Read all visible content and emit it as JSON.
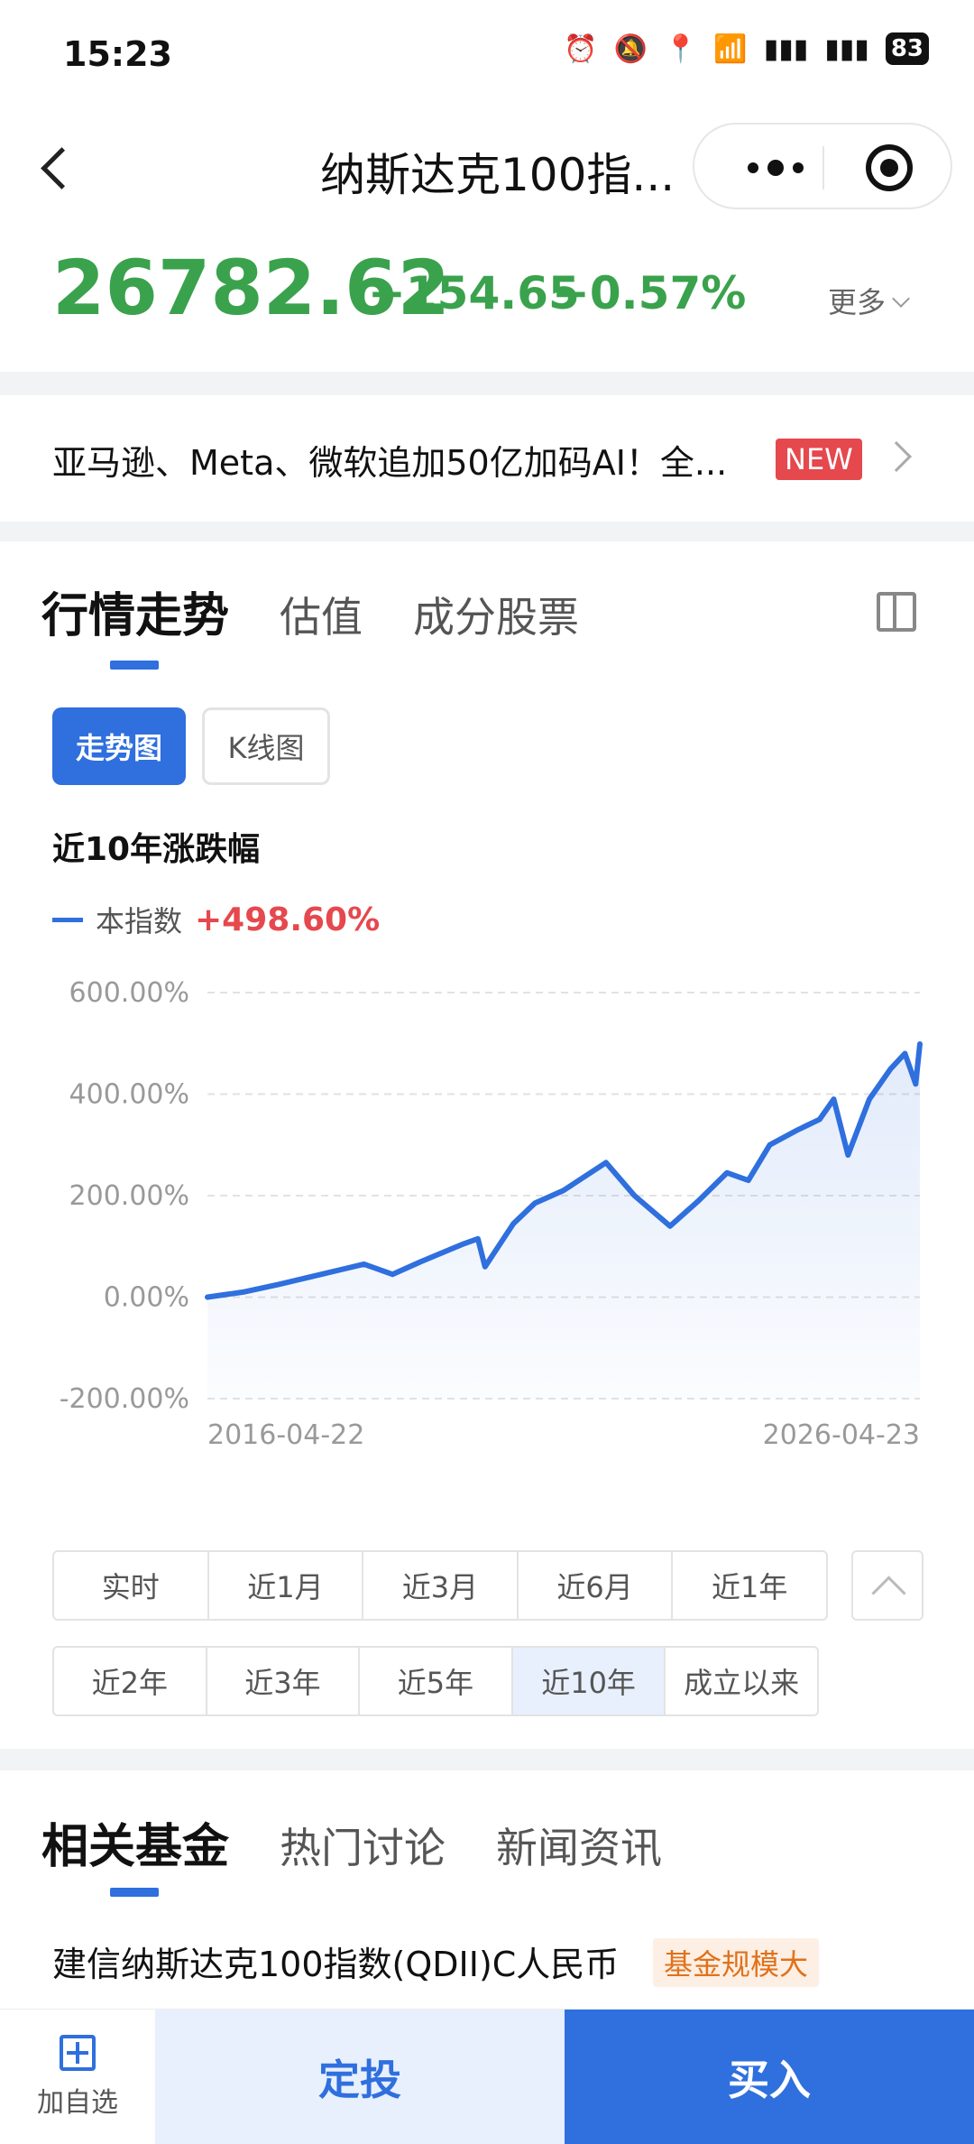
{
  "status": {
    "time": "15:23",
    "battery": "83"
  },
  "nav": {
    "title": "纳斯达克100指..."
  },
  "quote": {
    "price": "26782.62",
    "change": "−154.65",
    "change_pct": "−0.57%",
    "more": "更多"
  },
  "news": {
    "headline": "亚马逊、Meta、微软追加50亿加码AI！全...",
    "badge": "NEW"
  },
  "market_tabs": [
    "行情走势",
    "估值",
    "成分股票"
  ],
  "chart_types": {
    "trend": "走势图",
    "kline": "K线图"
  },
  "period_title": "近10年涨跌幅",
  "legend": {
    "name": "本指数",
    "value": "+498.60%"
  },
  "chart_data": {
    "type": "area",
    "ylim": [
      -200,
      600
    ],
    "y_ticks": [
      "600.00%",
      "400.00%",
      "200.00%",
      "0.00%",
      "-200.00%"
    ],
    "x_start_label": "2016-04-22",
    "x_end_label": "2026-04-23",
    "series": [
      {
        "name": "本指数",
        "color": "#2f6fde",
        "x": [
          2016.3,
          2016.8,
          2017.3,
          2017.9,
          2018.5,
          2018.9,
          2019.3,
          2019.9,
          2020.1,
          2020.2,
          2020.6,
          2020.9,
          2021.3,
          2021.9,
          2022.3,
          2022.8,
          2023.2,
          2023.6,
          2023.9,
          2024.2,
          2024.6,
          2024.9,
          2025.1,
          2025.3,
          2025.6,
          2025.9,
          2026.1,
          2026.25,
          2026.31
        ],
        "values": [
          0,
          10,
          25,
          45,
          65,
          45,
          70,
          105,
          115,
          60,
          145,
          185,
          210,
          265,
          200,
          140,
          190,
          245,
          230,
          300,
          330,
          350,
          390,
          280,
          390,
          450,
          480,
          420,
          498.6
        ]
      }
    ]
  },
  "range_row1": [
    "实时",
    "近1月",
    "近3月",
    "近6月",
    "近1年"
  ],
  "range_row2": [
    "近2年",
    "近3年",
    "近5年",
    "近10年",
    "成立以来"
  ],
  "selected_range": "近10年",
  "related_tabs": [
    "相关基金",
    "热门讨论",
    "新闻资讯"
  ],
  "fund": {
    "name": "建信纳斯达克100指数(QDII)C人民币",
    "tag": "基金规模大"
  },
  "bottom": {
    "watch": "加自选",
    "sip": "定投",
    "buy": "买入"
  }
}
